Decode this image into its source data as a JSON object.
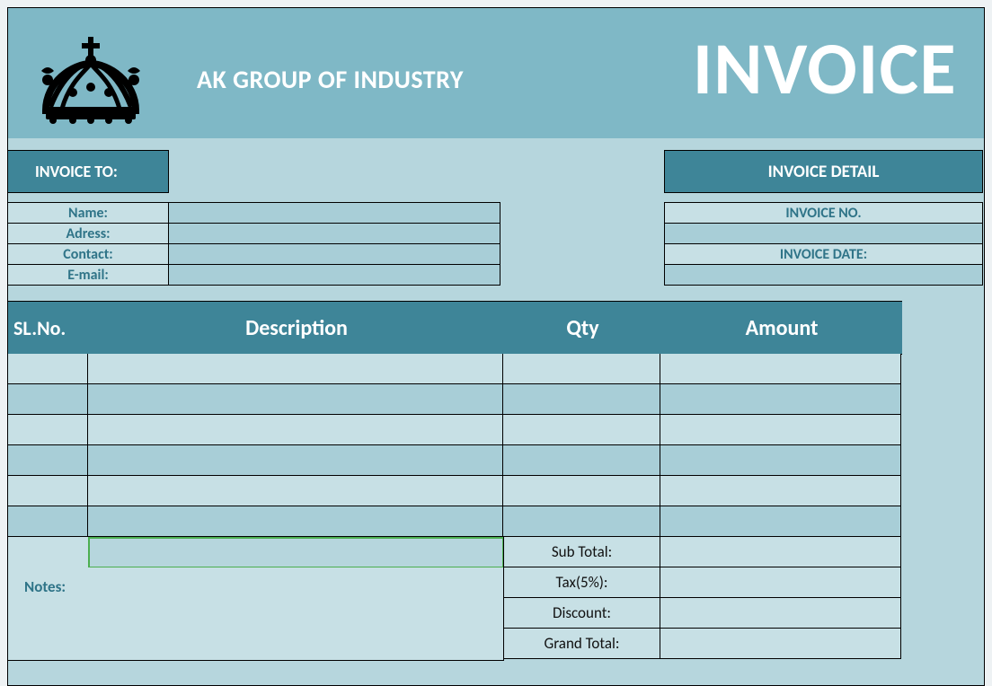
{
  "header": {
    "company": "AK GROUP OF INDUSTRY",
    "title": "INVOICE"
  },
  "invoice_to": {
    "heading": "INVOICE TO:",
    "fields": {
      "name_label": "Name:",
      "adress_label": "Adress:",
      "contact_label": "Contact:",
      "email_label": "E-mail:",
      "name_value": "",
      "adress_value": "",
      "contact_value": "",
      "email_value": ""
    }
  },
  "invoice_detail": {
    "heading": "INVOICE DETAIL",
    "no_label": "INVOICE NO.",
    "no_value": "",
    "date_label": "INVOICE DATE:",
    "date_value": ""
  },
  "table": {
    "headers": {
      "sl": "SL.No.",
      "desc": "Description",
      "qty": "Qty",
      "amt": "Amount"
    },
    "rows": [
      {
        "sl": "",
        "desc": "",
        "qty": "",
        "amt": ""
      },
      {
        "sl": "",
        "desc": "",
        "qty": "",
        "amt": ""
      },
      {
        "sl": "",
        "desc": "",
        "qty": "",
        "amt": ""
      },
      {
        "sl": "",
        "desc": "",
        "qty": "",
        "amt": ""
      },
      {
        "sl": "",
        "desc": "",
        "qty": "",
        "amt": ""
      },
      {
        "sl": "",
        "desc": "",
        "qty": "",
        "amt": ""
      }
    ]
  },
  "summary": {
    "subtotal_label": "Sub Total:",
    "subtotal_value": "",
    "tax_label": "Tax(5%):",
    "tax_value": "",
    "discount_label": "Discount:",
    "discount_value": "",
    "grand_label": "Grand Total:",
    "grand_value": ""
  },
  "notes_label": "Notes:"
}
